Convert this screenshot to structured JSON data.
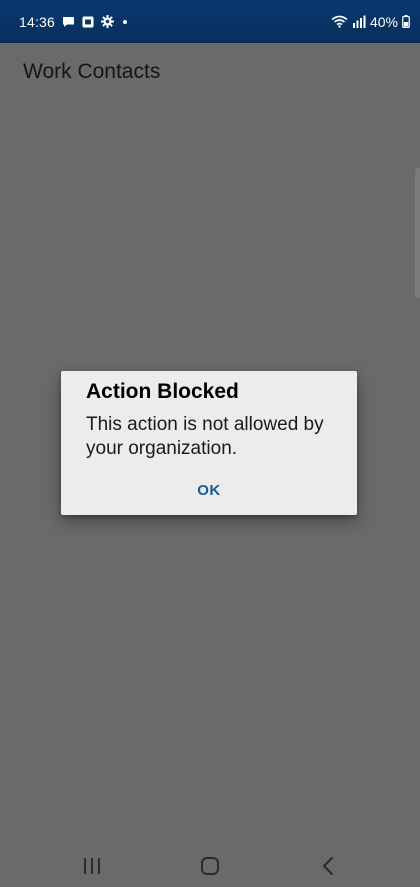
{
  "status_bar": {
    "time": "14:36",
    "battery": "40%",
    "notification_icons": [
      "message-icon",
      "outlook-icon",
      "gear-icon",
      "dot-icon"
    ],
    "system_icons": [
      "wifi-icon",
      "signal-icon",
      "battery-icon"
    ]
  },
  "app": {
    "title": "Work Contacts"
  },
  "dialog": {
    "title": "Action Blocked",
    "message": "This action is not allowed by your organization.",
    "ok_label": "OK"
  },
  "nav_bar": {
    "icons": [
      "recents-icon",
      "home-icon",
      "back-icon"
    ]
  },
  "colors": {
    "status_bar": "#073a73",
    "scrim_background": "#6a6a6a",
    "dialog_background": "#ececec",
    "dialog_button": "#1b5a8e"
  }
}
